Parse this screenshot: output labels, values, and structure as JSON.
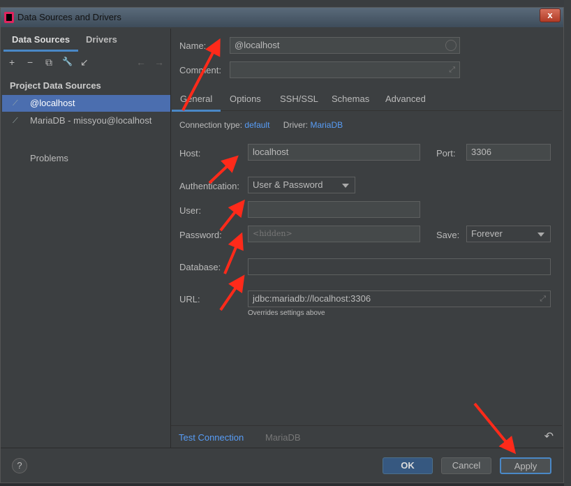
{
  "window": {
    "title": "Data Sources and Drivers",
    "close": "x"
  },
  "left": {
    "tabs": [
      "Data Sources",
      "Drivers"
    ],
    "toolbar": {
      "add": "+",
      "remove": "−",
      "copy": "⧉",
      "settings": "🔧",
      "import": "↙",
      "back": "←",
      "forward": "→"
    },
    "section": "Project Data Sources",
    "items": [
      "@localhost",
      "MariaDB - missyou@localhost"
    ],
    "problems": "Problems"
  },
  "form": {
    "name_label": "Name:",
    "name": "@localhost",
    "comment_label": "Comment:",
    "comment": "",
    "tabs": [
      "General",
      "Options",
      "SSH/SSL",
      "Schemas",
      "Advanced"
    ],
    "conn_type_label": "Connection type:",
    "conn_type": "default",
    "driver_label": "Driver:",
    "driver": "MariaDB",
    "host_label": "Host:",
    "host": "localhost",
    "port_label": "Port:",
    "port": "3306",
    "auth_label": "Authentication:",
    "auth": "User & Password",
    "user_label": "User:",
    "user": "",
    "password_label": "Password:",
    "password_placeholder": "<hidden>",
    "save_label": "Save:",
    "save": "Forever",
    "database_label": "Database:",
    "database": "",
    "url_label": "URL:",
    "url": "jdbc:mariadb://localhost:3306",
    "url_hint": "Overrides settings above"
  },
  "footer": {
    "test_connection": "Test Connection",
    "driver": "MariaDB",
    "revert": "↶"
  },
  "buttons": {
    "help": "?",
    "ok": "OK",
    "cancel": "Cancel",
    "apply": "Apply"
  },
  "colors": {
    "accent": "#4a88c7",
    "selection": "#4b6eaf",
    "link": "#589df6",
    "annotation": "#ff2a1a"
  }
}
